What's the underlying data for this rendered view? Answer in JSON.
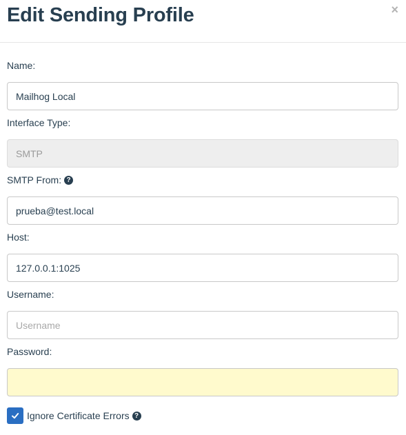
{
  "header": {
    "title": "Edit Sending Profile",
    "close_label": "×"
  },
  "form": {
    "name": {
      "label": "Name:",
      "value": "Mailhog Local"
    },
    "interface_type": {
      "label": "Interface Type:",
      "value": "SMTP"
    },
    "smtp_from": {
      "label": "SMTP From:",
      "value": "prueba@test.local",
      "help_icon": "question-circle-icon"
    },
    "host": {
      "label": "Host:",
      "value": "127.0.0.1:1025"
    },
    "username": {
      "label": "Username:",
      "value": "",
      "placeholder": "Username"
    },
    "password": {
      "label": "Password:",
      "value": ""
    },
    "ignore_cert": {
      "label": "Ignore Certificate Errors",
      "checked": true,
      "help_icon": "question-circle-icon"
    }
  },
  "colors": {
    "accent": "#2a6ec2",
    "text": "#283f50",
    "autofill": "#fffacd"
  }
}
